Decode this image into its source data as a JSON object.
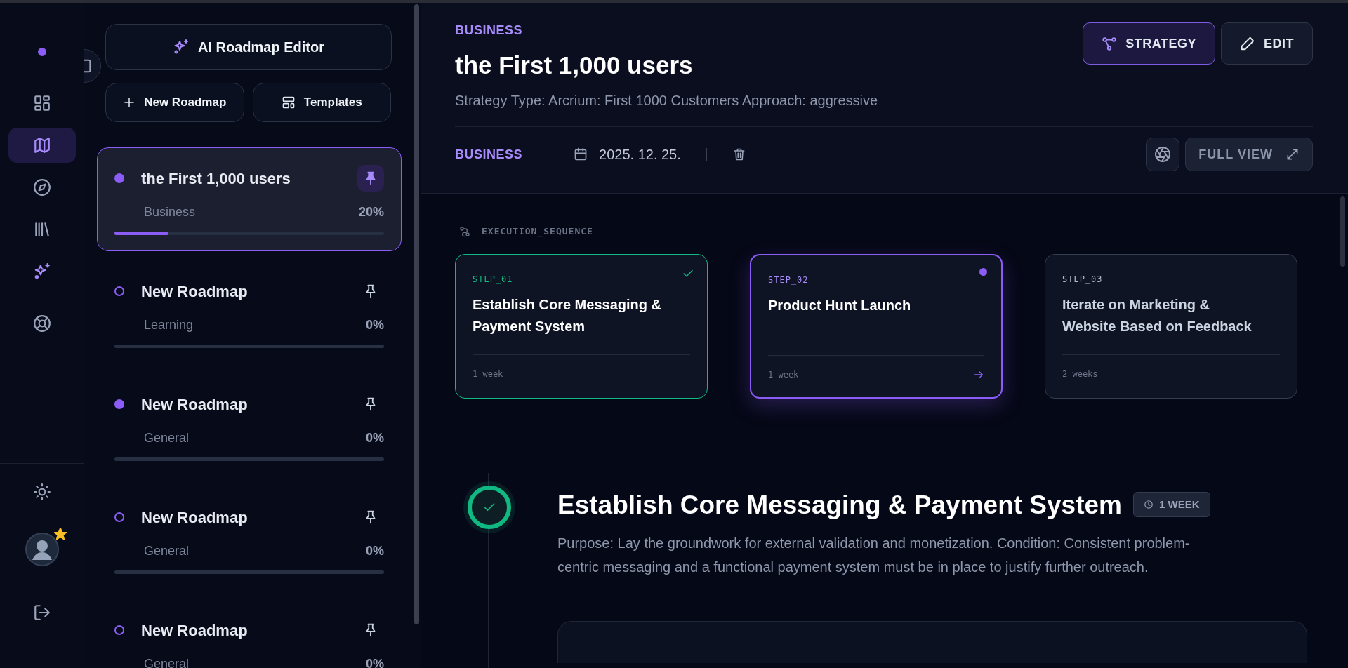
{
  "rail": {
    "top_items": [
      {
        "kind": "dot",
        "selected": false
      },
      {
        "kind": "dashboard",
        "selected": false
      },
      {
        "kind": "map",
        "selected": true
      },
      {
        "kind": "compass",
        "selected": false
      },
      {
        "kind": "library",
        "selected": false
      },
      {
        "kind": "sparkle",
        "selected": false
      },
      {
        "kind": "lifebuoy",
        "selected": false
      }
    ],
    "bottom_items": [
      {
        "kind": "sun"
      },
      {
        "kind": "avatar"
      },
      {
        "kind": "logout"
      }
    ]
  },
  "sidebar": {
    "editor_button": "AI Roadmap Editor",
    "new_button": "New Roadmap",
    "templates_button": "Templates",
    "roadmaps": [
      {
        "title": "the First 1,000 users",
        "category": "Business",
        "progress": "20%",
        "level": 0.2,
        "selected": true,
        "pinned": true,
        "started": true
      },
      {
        "title": "New Roadmap",
        "category": "Learning",
        "progress": "0%",
        "level": 0,
        "selected": false,
        "pinned": false,
        "started": false
      },
      {
        "title": "New Roadmap",
        "category": "General",
        "progress": "0%",
        "level": 0,
        "selected": false,
        "pinned": false,
        "started": true
      },
      {
        "title": "New Roadmap",
        "category": "General",
        "progress": "0%",
        "level": 0,
        "selected": false,
        "pinned": false,
        "started": false
      },
      {
        "title": "New Roadmap",
        "category": "General",
        "progress": "0%",
        "selected": false,
        "pinned": false,
        "started": false
      }
    ]
  },
  "header": {
    "category": "BUSINESS",
    "title": "the First 1,000 users",
    "subtitle": "Strategy Type: Arcrium: First 1000 Customers Approach: aggressive",
    "buttons": [
      {
        "kind": "strategy",
        "label": "STRATEGY",
        "selected": true
      },
      {
        "kind": "edit",
        "label": "EDIT",
        "selected": false
      }
    ],
    "meta_category": "BUSINESS",
    "date": "2025. 12. 25.",
    "full_view": "FULL VIEW"
  },
  "sequence": {
    "label": "EXECUTION_SEQUENCE",
    "steps": [
      {
        "step": "STEP_01",
        "title": "Establish Core Messaging & Payment System",
        "duration": "1 week",
        "kind": "done"
      },
      {
        "step": "STEP_02",
        "title": "Product Hunt Launch",
        "duration": "1 week",
        "kind": "current"
      },
      {
        "step": "STEP_03",
        "title": "Iterate on Marketing & Website Based on Feedback",
        "duration": "2 weeks",
        "kind": "pending"
      }
    ]
  },
  "detail": {
    "title": "Establish Core Messaging & Payment System",
    "badge": "1 WEEK",
    "kind": "done",
    "text": "Purpose: Lay the groundwork for external validation and monetization. Condition: Consistent problem-centric messaging and a functional payment system must be in place to justify further outreach."
  }
}
